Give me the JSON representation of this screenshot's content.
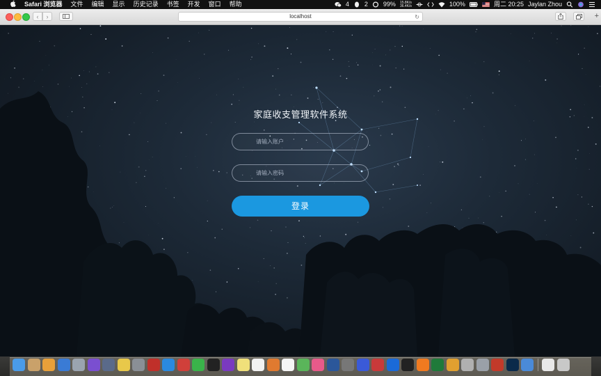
{
  "menubar": {
    "app_name": "Safari 浏览器",
    "menus": [
      "文件",
      "编辑",
      "显示",
      "历史记录",
      "书签",
      "开发",
      "窗口",
      "帮助"
    ],
    "wechat_count": "4",
    "qq_count": "2",
    "net_up": "15.8K/s",
    "net_down": "36.4K/s",
    "cpu": "99%",
    "battery": "100%",
    "clock": "周二 20:25",
    "user": "Jaylan Zhou"
  },
  "browser": {
    "url": "localhost"
  },
  "login": {
    "title": "家庭收支管理软件系统",
    "username_placeholder": "请输入账户",
    "password_placeholder": "请输入密码",
    "submit_label": "登录"
  },
  "colors": {
    "accent": "#1b98e0",
    "background": "#141d27"
  },
  "dock": {
    "icons": [
      "finder-icon",
      "notes-icon",
      "photos-icon",
      "preview-icon",
      "launchpad-icon",
      "intellij-icon",
      "database-icon",
      "cartoon-icon",
      "disk-utility-icon",
      "ruby-icon",
      "safari-icon",
      "mail-icon",
      "wechat-icon",
      "qq-icon",
      "axure-icon",
      "stickies-icon",
      "app-icon",
      "pages-icon",
      "calendar-icon",
      "maps-icon",
      "itunes-icon",
      "word-icon",
      "system-preferences-icon",
      "baidu-icon",
      "parallels-icon",
      "teamviewer-icon",
      "qq2-icon",
      "sublime-icon",
      "excel-icon",
      "keynote-icon",
      "archive-icon",
      "preview2-icon",
      "powerpoint-icon",
      "photoshop-icon",
      "chrome-icon",
      "trash-doc-icon",
      "trash-icon"
    ]
  }
}
